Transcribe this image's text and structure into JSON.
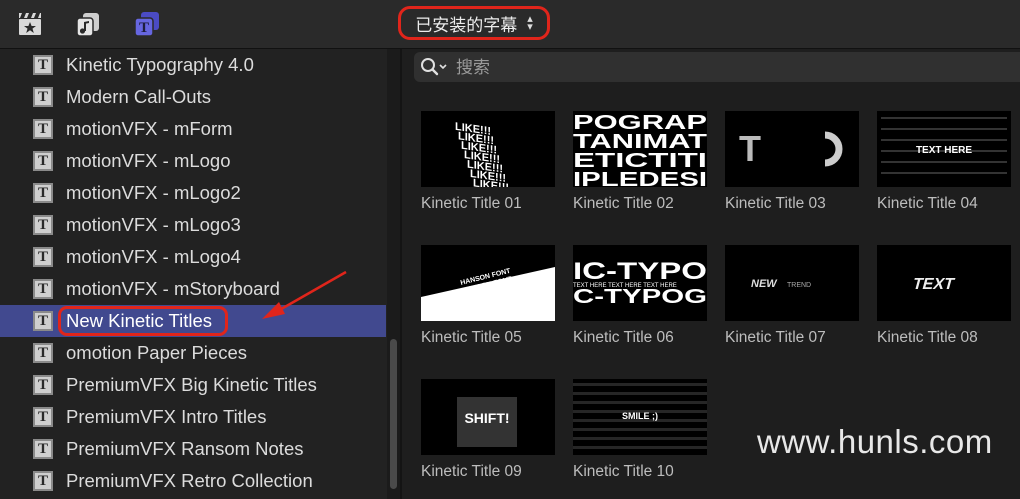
{
  "toolbar": {
    "icons": [
      "clapper-star-icon",
      "music-photo-icon",
      "titles-icon"
    ],
    "dropdown_label": "已安装的字幕",
    "dropdown_chevron": "⌃⌄"
  },
  "sidebar": {
    "items": [
      {
        "label": "Kinetic Typography 4.0",
        "selected": false
      },
      {
        "label": "Modern Call-Outs",
        "selected": false
      },
      {
        "label": "motionVFX - mForm",
        "selected": false
      },
      {
        "label": "motionVFX - mLogo",
        "selected": false
      },
      {
        "label": "motionVFX - mLogo2",
        "selected": false
      },
      {
        "label": "motionVFX - mLogo3",
        "selected": false
      },
      {
        "label": "motionVFX - mLogo4",
        "selected": false
      },
      {
        "label": "motionVFX - mStoryboard",
        "selected": false
      },
      {
        "label": "New Kinetic Titles",
        "selected": true
      },
      {
        "label": "omotion Paper Pieces",
        "selected": false
      },
      {
        "label": "PremiumVFX Big Kinetic Titles",
        "selected": false
      },
      {
        "label": "PremiumVFX Intro Titles",
        "selected": false
      },
      {
        "label": "PremiumVFX Ransom Notes",
        "selected": false
      },
      {
        "label": "PremiumVFX Retro Collection",
        "selected": false
      }
    ],
    "icon_glyph": "T"
  },
  "search": {
    "placeholder": "搜索"
  },
  "tiles": [
    {
      "label": "Kinetic Title 01"
    },
    {
      "label": "Kinetic Title 02"
    },
    {
      "label": "Kinetic Title 03"
    },
    {
      "label": "Kinetic Title 04"
    },
    {
      "label": "Kinetic Title 05"
    },
    {
      "label": "Kinetic Title 06"
    },
    {
      "label": "Kinetic Title 07"
    },
    {
      "label": "Kinetic Title 08"
    },
    {
      "label": "Kinetic Title 09"
    },
    {
      "label": "Kinetic Title 10"
    }
  ],
  "thumb_text": {
    "t01": "LIKE!!!",
    "t02": [
      "POGRAP",
      "TANIMAT",
      "ETICTITI",
      "IPLEDESI"
    ],
    "t03": "T",
    "t04": "TEXT HERE",
    "t05": [
      "HANSON FONT",
      "HANSON FONT"
    ],
    "t06": [
      "IC-TYPO",
      "C-TYPOG",
      "TEXT HERE TEXT HERE TEXT HERE"
    ],
    "t07": [
      "NEW",
      "TREND"
    ],
    "t08": "TEXT",
    "t09": "SHIFT!",
    "t10": "SMILE ;)"
  },
  "watermark": "www.hunls.com",
  "colors": {
    "accent_red": "#e0251b",
    "selection": "#41498f",
    "titles_icon": "#5b5bd6"
  }
}
